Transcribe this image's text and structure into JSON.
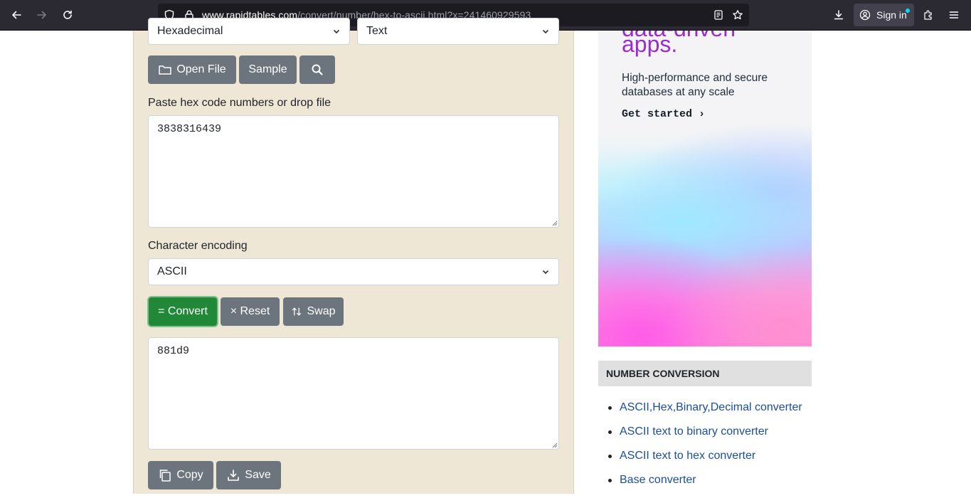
{
  "browser": {
    "url_host": "www.rapidtables.com",
    "url_path": "/convert/number/hex-to-ascii.html?x=241460929593",
    "signin_label": "Sign in"
  },
  "converter": {
    "from_select": "Hexadecimal",
    "to_select": "Text",
    "open_file_label": "Open File",
    "sample_label": "Sample",
    "input_label": "Paste hex code numbers or drop file",
    "input_value": "3838316439",
    "encoding_label": "Character encoding",
    "encoding_value": "ASCII",
    "convert_label": "= Convert",
    "reset_label": "× Reset",
    "swap_label": "Swap",
    "output_value": "881d9",
    "copy_label": "Copy",
    "save_label": "Save"
  },
  "ad": {
    "headline_top": "data-driven",
    "headline": "apps.",
    "subtext": "High-performance and secure databases at any scale",
    "cta": "Get started ›",
    "accent_color": "#9a2ccd"
  },
  "sidebar": {
    "heading": "NUMBER CONVERSION",
    "links": [
      "ASCII,Hex,Binary,Decimal converter",
      "ASCII text to binary converter",
      "ASCII text to hex converter",
      "Base converter"
    ]
  }
}
